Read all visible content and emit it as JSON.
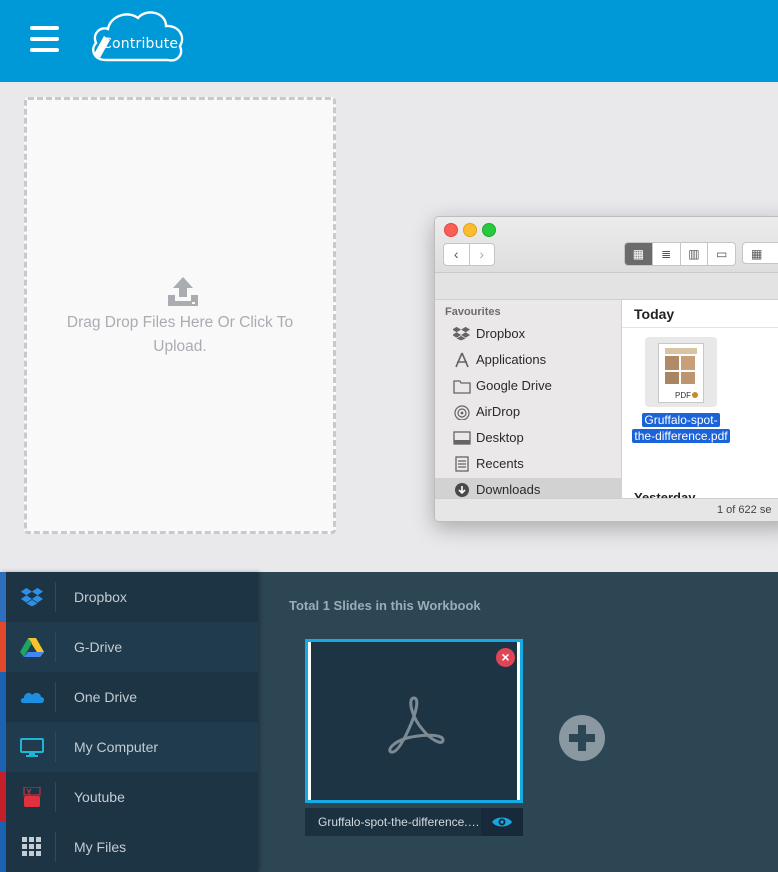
{
  "header": {
    "logo_text": "Contribute"
  },
  "dropzone": {
    "text": "Drag Drop Files Here Or Click To Upload."
  },
  "finder": {
    "sidebar_heading": "Favourites",
    "items": [
      {
        "label": "Dropbox",
        "icon": "dropbox-icon"
      },
      {
        "label": "Applications",
        "icon": "applications-icon"
      },
      {
        "label": "Google Drive",
        "icon": "folder-icon"
      },
      {
        "label": "AirDrop",
        "icon": "airdrop-icon"
      },
      {
        "label": "Desktop",
        "icon": "desktop-icon"
      },
      {
        "label": "Recents",
        "icon": "recents-icon"
      },
      {
        "label": "Downloads",
        "icon": "downloads-icon"
      }
    ],
    "section_today": "Today",
    "file_name_line1": "Gruffalo-spot-",
    "file_name_line2": "the-difference.pdf",
    "file_badge": "PDF",
    "section_yesterday": "Yesterday",
    "status": "1 of 622 se"
  },
  "sources": {
    "items": [
      {
        "label": "Dropbox",
        "icon": "dropbox-icon",
        "accent": "#2d6fbd"
      },
      {
        "label": "G-Drive",
        "icon": "google-drive-icon",
        "accent": "#e2492c"
      },
      {
        "label": "One Drive",
        "icon": "onedrive-icon",
        "accent": "#1b62b0"
      },
      {
        "label": "My Computer",
        "icon": "monitor-icon",
        "accent": "#1b62b0"
      },
      {
        "label": "Youtube",
        "icon": "youtube-icon",
        "accent": "#c4202c"
      },
      {
        "label": "My Files",
        "icon": "grid-icon",
        "accent": "#1b62b0"
      }
    ]
  },
  "workbook": {
    "title": "Total 1 Slides in this Workbook",
    "slide_name": "Gruffalo-spot-the-difference.pdf"
  },
  "colors": {
    "header": "#0099d8",
    "sidebar": "#1d3445",
    "panel": "#2d4654",
    "selected_border": "#16aae4",
    "close": "#e04555"
  }
}
